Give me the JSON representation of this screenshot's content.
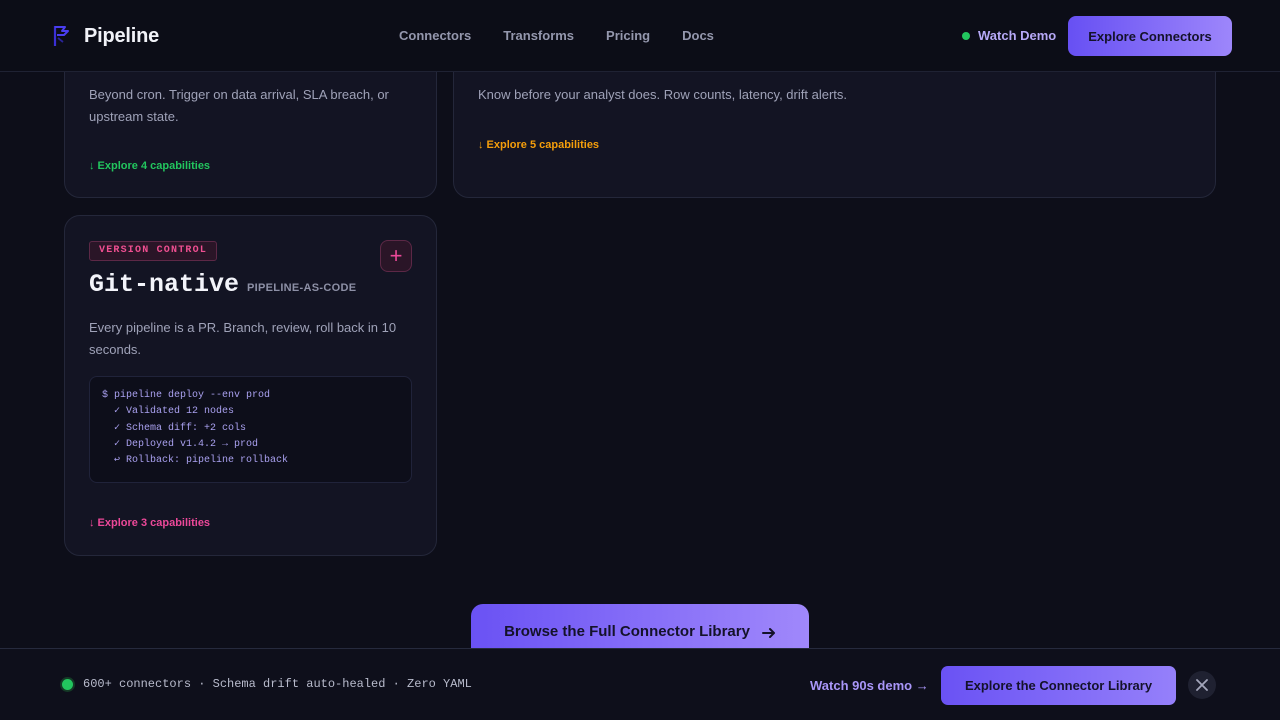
{
  "nav": {
    "brand": "Pipeline",
    "links": [
      "Connectors",
      "Transforms",
      "Pricing",
      "Docs"
    ],
    "watch_demo": "Watch Demo",
    "cta": "Explore Connectors"
  },
  "cards": [
    {
      "description": "Beyond cron. Trigger on data arrival, SLA breach, or upstream state.",
      "explore": "↓ Explore 4 capabilities",
      "accent": "#22c55e"
    },
    {
      "description": "Know before your analyst does. Row counts, latency, drift alerts.",
      "explore": "↓ Explore 5 capabilities",
      "accent": "#f59e0b"
    },
    {
      "tag": "VERSION CONTROL",
      "title": "Git-native",
      "subtitle": "PIPELINE-AS-CODE",
      "description": "Every pipeline is a PR. Branch, review, roll back in 10 seconds.",
      "code": [
        "$ pipeline deploy --env prod",
        "  ✓ Validated 12 nodes",
        "  ✓ Schema diff: +2 cols",
        "  ✓ Deployed v1.4.2 → prod",
        "  ↩ Rollback: pipeline rollback"
      ],
      "explore": "↓ Explore 3 capabilities",
      "accent": "#ec4899"
    }
  ],
  "browse": {
    "label": "Browse the Full Connector Library"
  },
  "bottom_bar": {
    "status": "600+ connectors · Schema drift auto-healed · Zero YAML",
    "demo_link": "Watch 90s demo →",
    "cta": "Explore the Connector Library"
  }
}
